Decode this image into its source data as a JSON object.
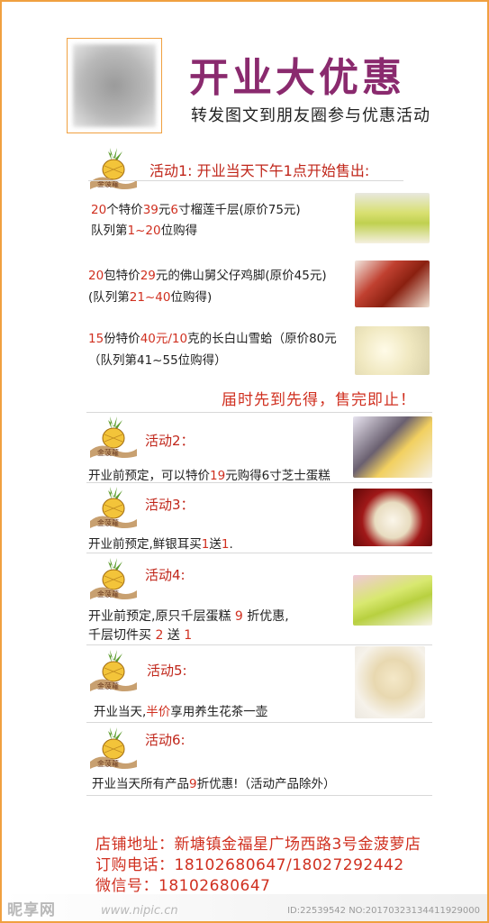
{
  "header": {
    "title": "开业大优惠",
    "subtitle": "转发图文到朋友圈参与优惠活动"
  },
  "activity1": {
    "heading": "活动1: 开业当天下午1点开始售出:",
    "items": [
      {
        "l1_a": "20",
        "l1_b": "个特价",
        "l1_c": "39",
        "l1_d": "元",
        "l1_e": "6",
        "l1_f": "寸榴莲千层(原价75元)",
        "l2_a": "队列第",
        "l2_b": "1~20",
        "l2_c": "位购得"
      },
      {
        "l1_a": "20",
        "l1_b": "包特价",
        "l1_c": "29",
        "l1_d": "元的佛山舅父仔鸡脚(原价45元)",
        "l2_a": "(队列第",
        "l2_b": "21~40",
        "l2_c": "位购得)"
      },
      {
        "l1_a": "15",
        "l1_b": "份特价",
        "l1_c": "40元/10",
        "l1_d": "克的长白山雪蛤（原价80元",
        "l2_a": "（队列第41~55位购得）",
        "l2_b": "",
        "l2_c": ""
      }
    ],
    "closing": "届时先到先得，售完即止！"
  },
  "activity2": {
    "heading": "活动2：",
    "t_a": "开业前预定，可以特价",
    "t_b": "19",
    "t_c": "元购得6寸芝士蛋糕"
  },
  "activity3": {
    "heading": "活动3：",
    "t_a": "开业前预定,鲜银耳买",
    "t_b": "1",
    "t_c": "送",
    "t_d": "1",
    "t_e": "."
  },
  "activity4": {
    "heading": "活动4:",
    "t1_a": "开业前预定,原只千层蛋糕 ",
    "t1_b": "9",
    "t1_c": " 折优惠,",
    "t2_a": "千层切件买 ",
    "t2_b": "2",
    "t2_c": " 送 ",
    "t2_d": "1"
  },
  "activity5": {
    "heading": "活动5:",
    "t_a": "开业当天,",
    "t_b": "半价",
    "t_c": "享用养生花茶一壶"
  },
  "activity6": {
    "heading": "活动6:",
    "t_a": "开业当天所有产品",
    "t_b": "9",
    "t_c": "折优惠!（活动产品除外）"
  },
  "footer": {
    "address": "店铺地址：新塘镇金福星广场西路3号金菠萝店",
    "phone": "订购电话：18102680647/18027292442",
    "wechat": "微信号：18102680647"
  },
  "watermark": {
    "logo": "昵享网",
    "url": "www.nipic.cn",
    "id": "ID:22539542 NO:20170323134411929000"
  },
  "colors": {
    "accent": "#8a2a6e",
    "highlight": "#d03020",
    "border": "#f0a040"
  }
}
